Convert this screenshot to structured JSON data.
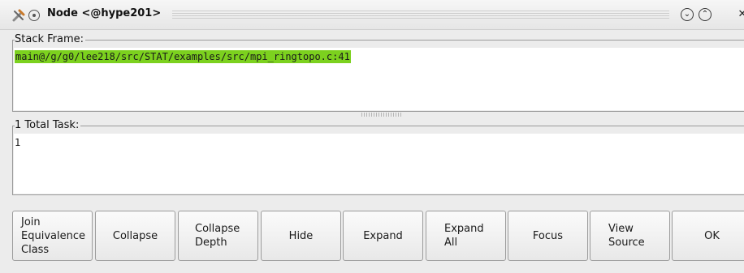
{
  "window": {
    "title": "Node <@hype201>",
    "controls": {
      "minimize": "⌄",
      "maximize": "⌃",
      "close": "✕"
    },
    "icons": {
      "app": "tools-icon",
      "pin": "pin-icon"
    }
  },
  "stack_frame": {
    "label": "Stack Frame:",
    "value": "main@/g/g0/lee218/src/STAT/examples/src/mpi_ringtopo.c:41",
    "highlight_color": "#7cd11e"
  },
  "tasks": {
    "label": "1 Total Task:",
    "value": "1"
  },
  "buttons": [
    {
      "id": "join-equivalence-class",
      "label": "Join\nEquivalence\nClass"
    },
    {
      "id": "collapse",
      "label": "Collapse"
    },
    {
      "id": "collapse-depth",
      "label": "Collapse\nDepth"
    },
    {
      "id": "hide",
      "label": "Hide"
    },
    {
      "id": "expand",
      "label": "Expand"
    },
    {
      "id": "expand-all",
      "label": "Expand\nAll"
    },
    {
      "id": "focus",
      "label": "Focus"
    },
    {
      "id": "view-source",
      "label": "View\nSource"
    },
    {
      "id": "ok",
      "label": "OK"
    }
  ]
}
